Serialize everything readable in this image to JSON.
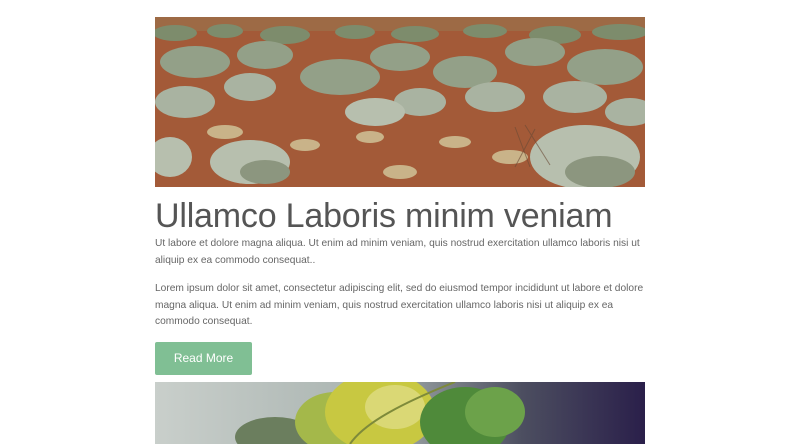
{
  "posts": [
    {
      "image": "desert-shrubland-photo",
      "title": "Ullamco Laboris minim veniam",
      "excerpt": "Ut labore et dolore magna aliqua. Ut enim ad minim veniam, quis nostrud exercitation ullamco laboris nisi ut aliquip ex ea commodo consequat..",
      "body": "Lorem ipsum dolor sit amet, consectetur adipiscing elit, sed do eiusmod tempor incididunt ut labore et dolore magna aliqua. Ut enim ad minim veniam, quis nostrud exercitation ullamco laboris nisi ut aliquip ex ea commodo consequat.",
      "button_label": "Read More"
    },
    {
      "image": "green-leaves-photo"
    }
  ],
  "colors": {
    "button": "#80bf94",
    "title": "#555555",
    "text": "#666666"
  }
}
